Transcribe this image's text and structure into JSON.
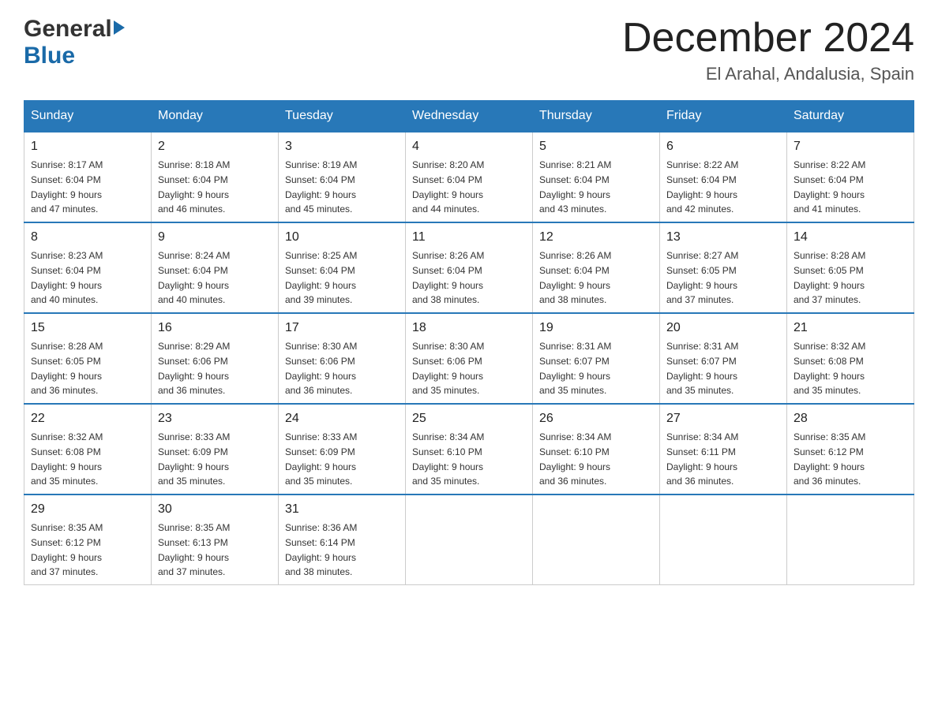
{
  "header": {
    "logo": {
      "general": "General",
      "blue": "Blue"
    },
    "title": "December 2024",
    "location": "El Arahal, Andalusia, Spain"
  },
  "days_of_week": [
    "Sunday",
    "Monday",
    "Tuesday",
    "Wednesday",
    "Thursday",
    "Friday",
    "Saturday"
  ],
  "weeks": [
    [
      {
        "day": "1",
        "sunrise": "8:17 AM",
        "sunset": "6:04 PM",
        "daylight": "9 hours and 47 minutes."
      },
      {
        "day": "2",
        "sunrise": "8:18 AM",
        "sunset": "6:04 PM",
        "daylight": "9 hours and 46 minutes."
      },
      {
        "day": "3",
        "sunrise": "8:19 AM",
        "sunset": "6:04 PM",
        "daylight": "9 hours and 45 minutes."
      },
      {
        "day": "4",
        "sunrise": "8:20 AM",
        "sunset": "6:04 PM",
        "daylight": "9 hours and 44 minutes."
      },
      {
        "day": "5",
        "sunrise": "8:21 AM",
        "sunset": "6:04 PM",
        "daylight": "9 hours and 43 minutes."
      },
      {
        "day": "6",
        "sunrise": "8:22 AM",
        "sunset": "6:04 PM",
        "daylight": "9 hours and 42 minutes."
      },
      {
        "day": "7",
        "sunrise": "8:22 AM",
        "sunset": "6:04 PM",
        "daylight": "9 hours and 41 minutes."
      }
    ],
    [
      {
        "day": "8",
        "sunrise": "8:23 AM",
        "sunset": "6:04 PM",
        "daylight": "9 hours and 40 minutes."
      },
      {
        "day": "9",
        "sunrise": "8:24 AM",
        "sunset": "6:04 PM",
        "daylight": "9 hours and 40 minutes."
      },
      {
        "day": "10",
        "sunrise": "8:25 AM",
        "sunset": "6:04 PM",
        "daylight": "9 hours and 39 minutes."
      },
      {
        "day": "11",
        "sunrise": "8:26 AM",
        "sunset": "6:04 PM",
        "daylight": "9 hours and 38 minutes."
      },
      {
        "day": "12",
        "sunrise": "8:26 AM",
        "sunset": "6:04 PM",
        "daylight": "9 hours and 38 minutes."
      },
      {
        "day": "13",
        "sunrise": "8:27 AM",
        "sunset": "6:05 PM",
        "daylight": "9 hours and 37 minutes."
      },
      {
        "day": "14",
        "sunrise": "8:28 AM",
        "sunset": "6:05 PM",
        "daylight": "9 hours and 37 minutes."
      }
    ],
    [
      {
        "day": "15",
        "sunrise": "8:28 AM",
        "sunset": "6:05 PM",
        "daylight": "9 hours and 36 minutes."
      },
      {
        "day": "16",
        "sunrise": "8:29 AM",
        "sunset": "6:06 PM",
        "daylight": "9 hours and 36 minutes."
      },
      {
        "day": "17",
        "sunrise": "8:30 AM",
        "sunset": "6:06 PM",
        "daylight": "9 hours and 36 minutes."
      },
      {
        "day": "18",
        "sunrise": "8:30 AM",
        "sunset": "6:06 PM",
        "daylight": "9 hours and 35 minutes."
      },
      {
        "day": "19",
        "sunrise": "8:31 AM",
        "sunset": "6:07 PM",
        "daylight": "9 hours and 35 minutes."
      },
      {
        "day": "20",
        "sunrise": "8:31 AM",
        "sunset": "6:07 PM",
        "daylight": "9 hours and 35 minutes."
      },
      {
        "day": "21",
        "sunrise": "8:32 AM",
        "sunset": "6:08 PM",
        "daylight": "9 hours and 35 minutes."
      }
    ],
    [
      {
        "day": "22",
        "sunrise": "8:32 AM",
        "sunset": "6:08 PM",
        "daylight": "9 hours and 35 minutes."
      },
      {
        "day": "23",
        "sunrise": "8:33 AM",
        "sunset": "6:09 PM",
        "daylight": "9 hours and 35 minutes."
      },
      {
        "day": "24",
        "sunrise": "8:33 AM",
        "sunset": "6:09 PM",
        "daylight": "9 hours and 35 minutes."
      },
      {
        "day": "25",
        "sunrise": "8:34 AM",
        "sunset": "6:10 PM",
        "daylight": "9 hours and 35 minutes."
      },
      {
        "day": "26",
        "sunrise": "8:34 AM",
        "sunset": "6:10 PM",
        "daylight": "9 hours and 36 minutes."
      },
      {
        "day": "27",
        "sunrise": "8:34 AM",
        "sunset": "6:11 PM",
        "daylight": "9 hours and 36 minutes."
      },
      {
        "day": "28",
        "sunrise": "8:35 AM",
        "sunset": "6:12 PM",
        "daylight": "9 hours and 36 minutes."
      }
    ],
    [
      {
        "day": "29",
        "sunrise": "8:35 AM",
        "sunset": "6:12 PM",
        "daylight": "9 hours and 37 minutes."
      },
      {
        "day": "30",
        "sunrise": "8:35 AM",
        "sunset": "6:13 PM",
        "daylight": "9 hours and 37 minutes."
      },
      {
        "day": "31",
        "sunrise": "8:36 AM",
        "sunset": "6:14 PM",
        "daylight": "9 hours and 38 minutes."
      },
      null,
      null,
      null,
      null
    ]
  ],
  "labels": {
    "sunrise": "Sunrise:",
    "sunset": "Sunset:",
    "daylight": "Daylight:"
  }
}
